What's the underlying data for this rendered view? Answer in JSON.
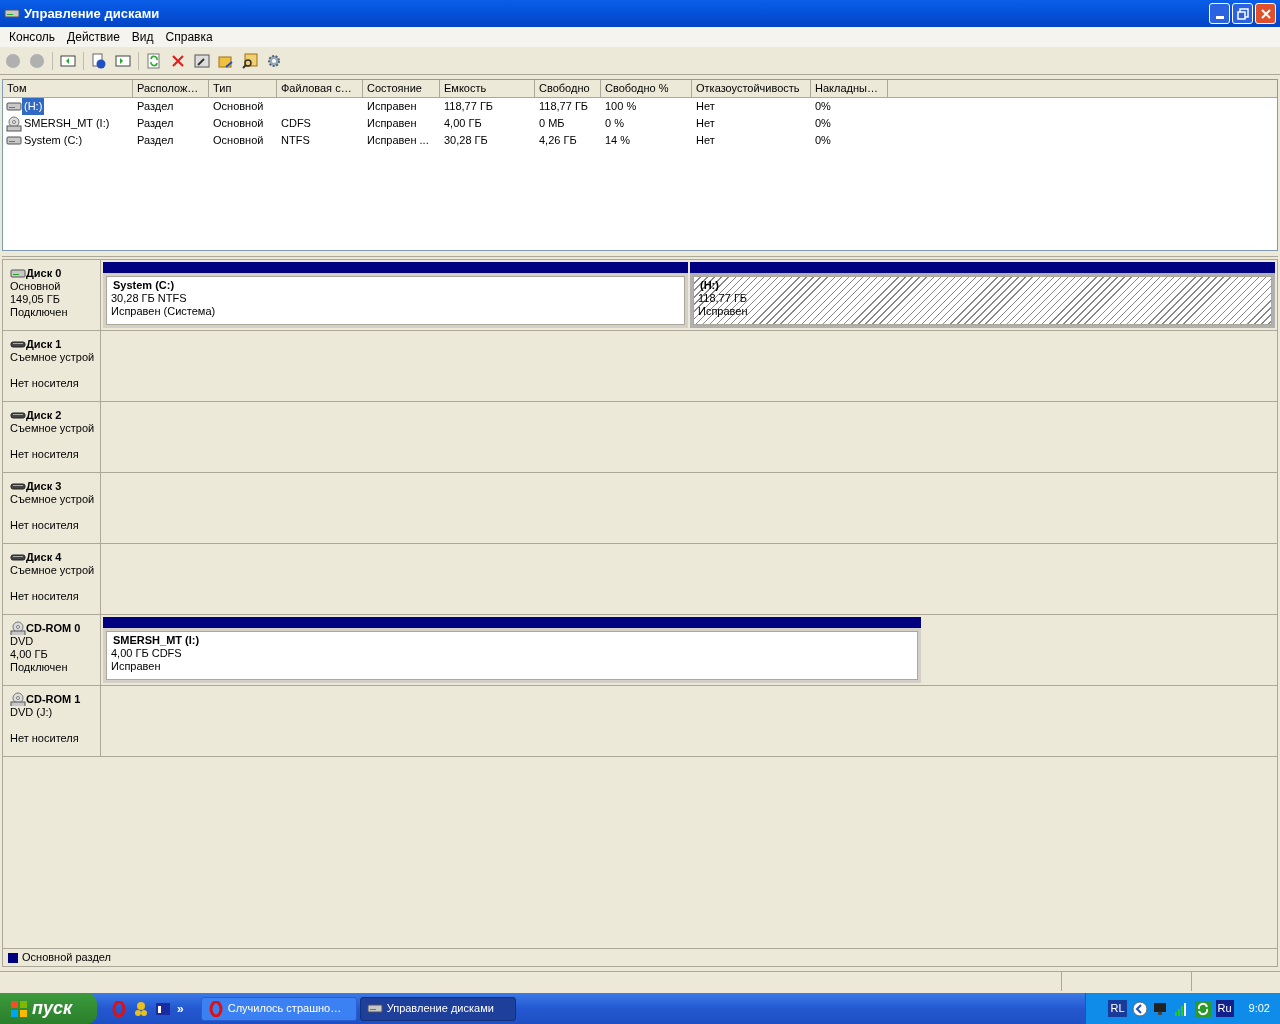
{
  "window": {
    "title": "Управление дисками"
  },
  "menu": [
    "Консоль",
    "Действие",
    "Вид",
    "Справка"
  ],
  "volumes": {
    "columns": [
      "Том",
      "Располож…",
      "Тип",
      "Файловая с…",
      "Состояние",
      "Емкость",
      "Свободно",
      "Свободно %",
      "Отказоустойчивость",
      "Накладны…"
    ],
    "rows": [
      {
        "selected": true,
        "kind": "disk",
        "cells": [
          "(H:)",
          "Раздел",
          "Основной",
          "",
          "Исправен",
          "118,77 ГБ",
          "118,77 ГБ",
          "100 %",
          "Нет",
          "0%"
        ]
      },
      {
        "selected": false,
        "kind": "cd",
        "cells": [
          "SMERSH_MT (I:)",
          "Раздел",
          "Основной",
          "CDFS",
          "Исправен",
          "4,00 ГБ",
          "0 МБ",
          "0 %",
          "Нет",
          "0%"
        ]
      },
      {
        "selected": false,
        "kind": "disk",
        "cells": [
          "System (C:)",
          "Раздел",
          "Основной",
          "NTFS",
          "Исправен ...",
          "30,28 ГБ",
          "4,26 ГБ",
          "14 %",
          "Нет",
          "0%"
        ]
      }
    ]
  },
  "disks": [
    {
      "kind": "disk",
      "name": "Диск 0",
      "type": "Основной",
      "size": "149,05 ГБ",
      "status": "Подключен",
      "partitions": [
        {
          "name": "System  (C:)",
          "size": "30,28 ГБ NTFS",
          "status": "Исправен (Система)",
          "hatched": false,
          "selected": false
        },
        {
          "name": "(H:)",
          "size": "118,77 ГБ",
          "status": "Исправен",
          "hatched": true,
          "selected": true
        }
      ]
    },
    {
      "kind": "removable",
      "name": "Диск 1",
      "type": "Съемное устрой",
      "status": "Нет носителя"
    },
    {
      "kind": "removable",
      "name": "Диск 2",
      "type": "Съемное устрой",
      "status": "Нет носителя"
    },
    {
      "kind": "removable",
      "name": "Диск 3",
      "type": "Съемное устрой",
      "status": "Нет носителя"
    },
    {
      "kind": "removable",
      "name": "Диск 4",
      "type": "Съемное устрой",
      "status": "Нет носителя"
    },
    {
      "kind": "cd",
      "name": "CD-ROM 0",
      "type": "DVD",
      "size": "4,00 ГБ",
      "status": "Подключен",
      "partitions": [
        {
          "name": "SMERSH_MT  (I:)",
          "size": "4,00 ГБ CDFS",
          "status": "Исправен",
          "hatched": false,
          "selected": false
        }
      ]
    },
    {
      "kind": "cd",
      "name": "CD-ROM 1",
      "type": "DVD (J:)",
      "status": "Нет носителя"
    }
  ],
  "legend": [
    {
      "label": "Основной раздел",
      "color": "#000080"
    }
  ],
  "taskbar": {
    "start": "пуск",
    "more": "»",
    "tasks": [
      {
        "kind": "browser",
        "label": "Случилось страшно…",
        "selected": false
      },
      {
        "kind": "disk",
        "label": "Управление дисками",
        "selected": true
      }
    ],
    "tray": {
      "lang": "RL",
      "ime": "Ru",
      "time": "9:02"
    }
  }
}
